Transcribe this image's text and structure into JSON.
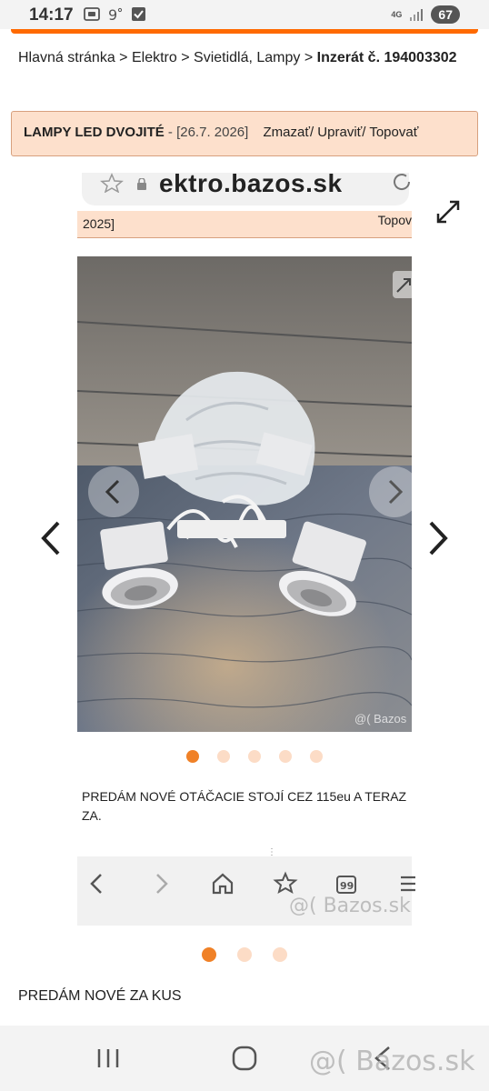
{
  "status_bar": {
    "time": "14:17",
    "network": "4G",
    "battery": "67"
  },
  "breadcrumb": {
    "home": "Hlavná stránka",
    "sep": ">",
    "category": "Elektro",
    "subcategory": "Svietidlá, Lampy",
    "current": "Inzerát č. 194003302"
  },
  "listing": {
    "title": "LAMPY LED DVOJITÉ",
    "date": "- [26.7. 2026]",
    "actions": "Zmazať/ Upraviť/ Topovať"
  },
  "embedded_screenshot": {
    "url_text": "ektro.bazos.sk",
    "header_date": "2025]",
    "header_action": "Topov",
    "description": "PREDÁM NOVÉ OTÁČACIE STOJÍ CEZ 115eu A TERAZ ZA.",
    "photo_watermark": "@( Bazos",
    "toolbar_watermark": "@( Bazos.sk",
    "gallery_dots": 5,
    "gallery_active": 0
  },
  "gallery": {
    "dots": 3,
    "active": 0
  },
  "description": "PREDÁM NOVÉ ZA KUS",
  "nav_watermark": "@( Bazos.sk",
  "colors": {
    "accent": "#ff6a00",
    "title_bg": "#fde0cc",
    "dot_active": "#f08127",
    "dot_inactive": "#fcdcc6"
  }
}
